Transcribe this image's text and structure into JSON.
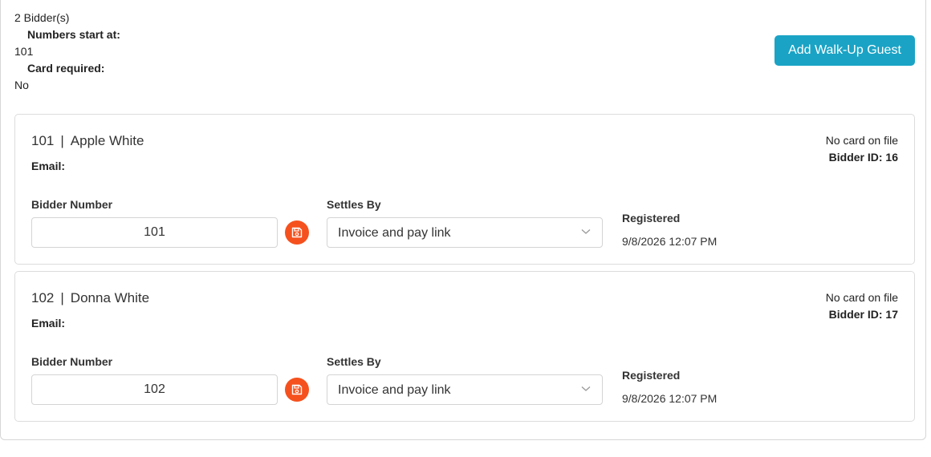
{
  "summary": {
    "bidder_count": "2 Bidder(s)",
    "numbers_start_label": "Numbers start at:",
    "numbers_start_value": "101",
    "card_required_label": "Card required:",
    "card_required_value": "No"
  },
  "actions": {
    "add_walkup_label": "Add Walk-Up Guest"
  },
  "labels": {
    "email": "Email:",
    "bidder_number": "Bidder Number",
    "settles_by": "Settles By",
    "registered": "Registered"
  },
  "bidders": [
    {
      "number": "101",
      "separator": "|",
      "name": "Apple White",
      "card_status": "No card on file",
      "bidder_id": "Bidder ID: 16",
      "settles_by": "Invoice and pay link",
      "registered_at": "9/8/2026 12:07 PM"
    },
    {
      "number": "102",
      "separator": "|",
      "name": "Donna White",
      "card_status": "No card on file",
      "bidder_id": "Bidder ID: 17",
      "settles_by": "Invoice and pay link",
      "registered_at": "9/8/2026 12:07 PM"
    }
  ],
  "colors": {
    "accent": "#1aa3c5",
    "save_button": "#f5511e",
    "border": "#dcdcdc"
  },
  "icons": {
    "save": "floppy-disk-icon",
    "dropdown": "chevron-down-icon"
  }
}
